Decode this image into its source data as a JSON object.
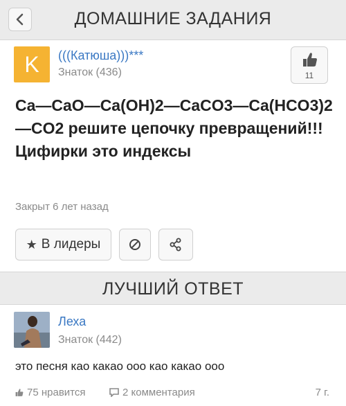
{
  "header": {
    "title": "ДОМАШНИЕ ЗАДАНИЯ",
    "back_icon": "chevron-left-icon"
  },
  "asker": {
    "avatar_letter": "K",
    "name": "(((Катюша)))***",
    "rank": "Знаток (436)",
    "like_count": "11"
  },
  "question": {
    "text": "Ca—CaO—Ca(OH)2—CaCO3—Ca(HCO3)2—CO2 решите цепочку превращений!!! Цифирки это индексы",
    "status": "Закрыт 6 лет назад"
  },
  "actions": {
    "leaders_label": "В лидеры"
  },
  "best_answer": {
    "section_title": "ЛУЧШИЙ ОТВЕТ",
    "author": "Леха",
    "rank": "Знаток (442)",
    "text": "это песня као какао ооо као какао ооо",
    "likes": "75 нравится",
    "comments": "2 комментария",
    "age": "7 г."
  },
  "colors": {
    "accent_link": "#3a78c3",
    "avatar_bg": "#f5b332",
    "bar_bg": "#ebebeb"
  }
}
